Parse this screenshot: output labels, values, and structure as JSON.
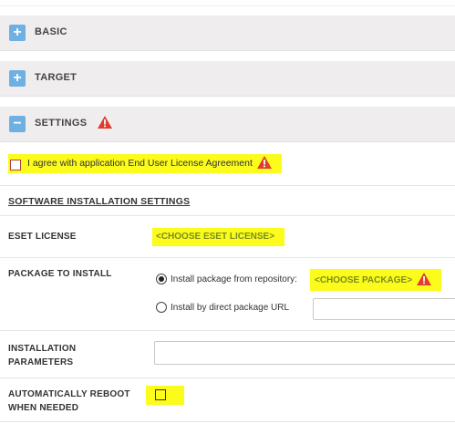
{
  "sections": {
    "basic": {
      "icon": "+",
      "title": "BASIC"
    },
    "target": {
      "icon": "+",
      "title": "TARGET"
    },
    "settings": {
      "icon": "−",
      "title": "SETTINGS"
    }
  },
  "eula": {
    "label": "I agree with application End User License Agreement",
    "checked": false
  },
  "software": {
    "heading": "SOFTWARE INSTALLATION SETTINGS"
  },
  "license": {
    "label": "ESET LICENSE",
    "value": "<CHOOSE ESET LICENSE>"
  },
  "package": {
    "label": "PACKAGE TO INSTALL",
    "option_repo": "Install package from repository:",
    "choose": "<CHOOSE PACKAGE>",
    "option_url": "Install by direct package URL",
    "url_value": ""
  },
  "install_params": {
    "label_line1": "INSTALLATION",
    "label_line2": "PARAMETERS",
    "value": ""
  },
  "reboot": {
    "label_line1": "AUTOMATICALLY REBOOT",
    "label_line2": "WHEN NEEDED",
    "checked": false
  },
  "colors": {
    "accent": "#6fb0e3",
    "warning": "#e03c31",
    "highlight": "#fbfb1c",
    "link": "#7a8c1e"
  },
  "icons": [
    "plus-icon",
    "minus-icon",
    "warning-icon",
    "radio-button",
    "checkbox"
  ]
}
